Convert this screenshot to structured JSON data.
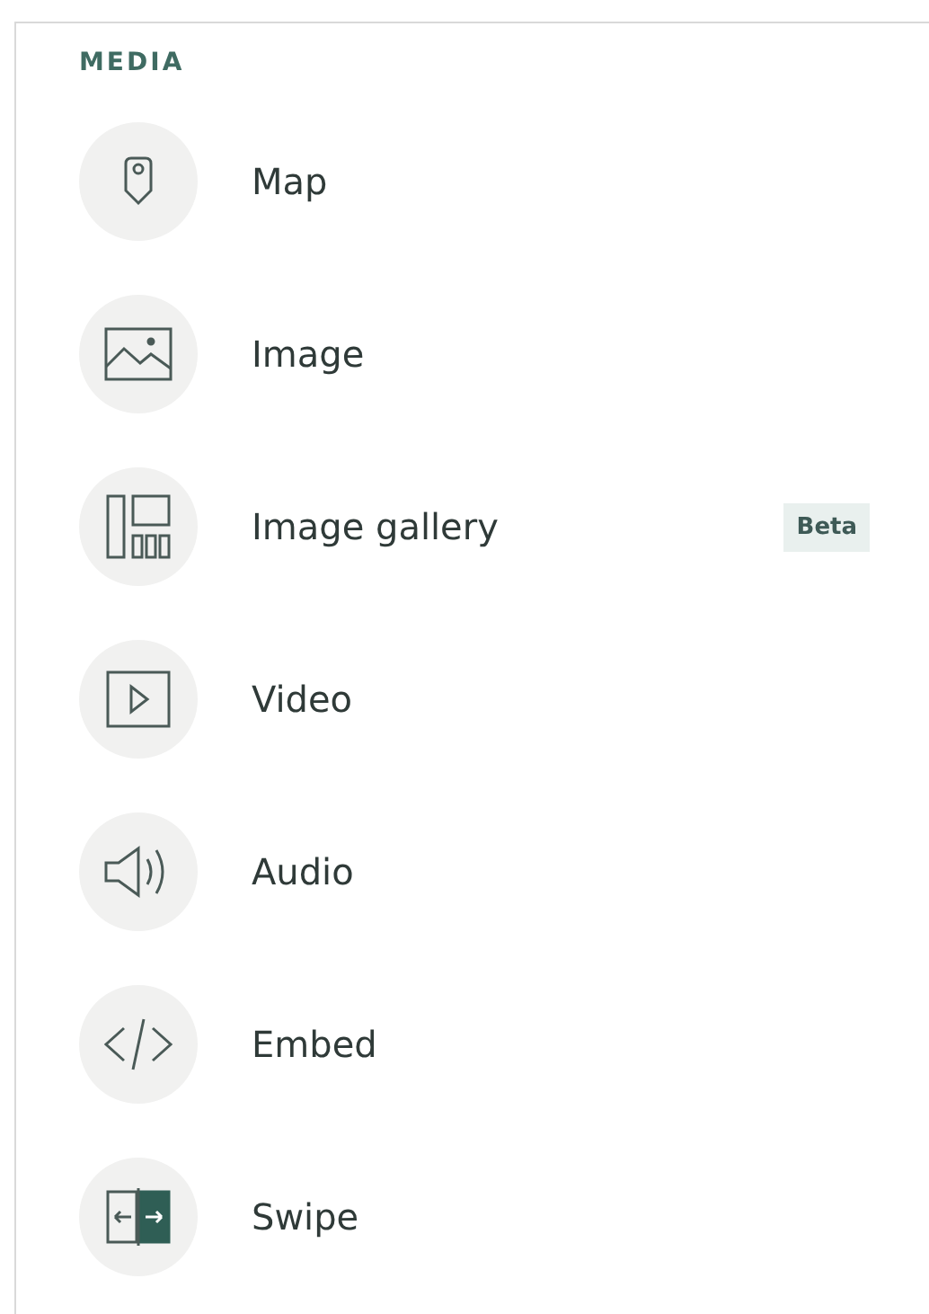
{
  "section": {
    "title": "MEDIA"
  },
  "items": [
    {
      "kind": "map",
      "label": "Map"
    },
    {
      "kind": "image",
      "label": "Image"
    },
    {
      "kind": "gallery",
      "label": "Image gallery",
      "badge": "Beta"
    },
    {
      "kind": "video",
      "label": "Video"
    },
    {
      "kind": "audio",
      "label": "Audio"
    },
    {
      "kind": "embed",
      "label": "Embed"
    },
    {
      "kind": "swipe",
      "label": "Swipe"
    }
  ]
}
